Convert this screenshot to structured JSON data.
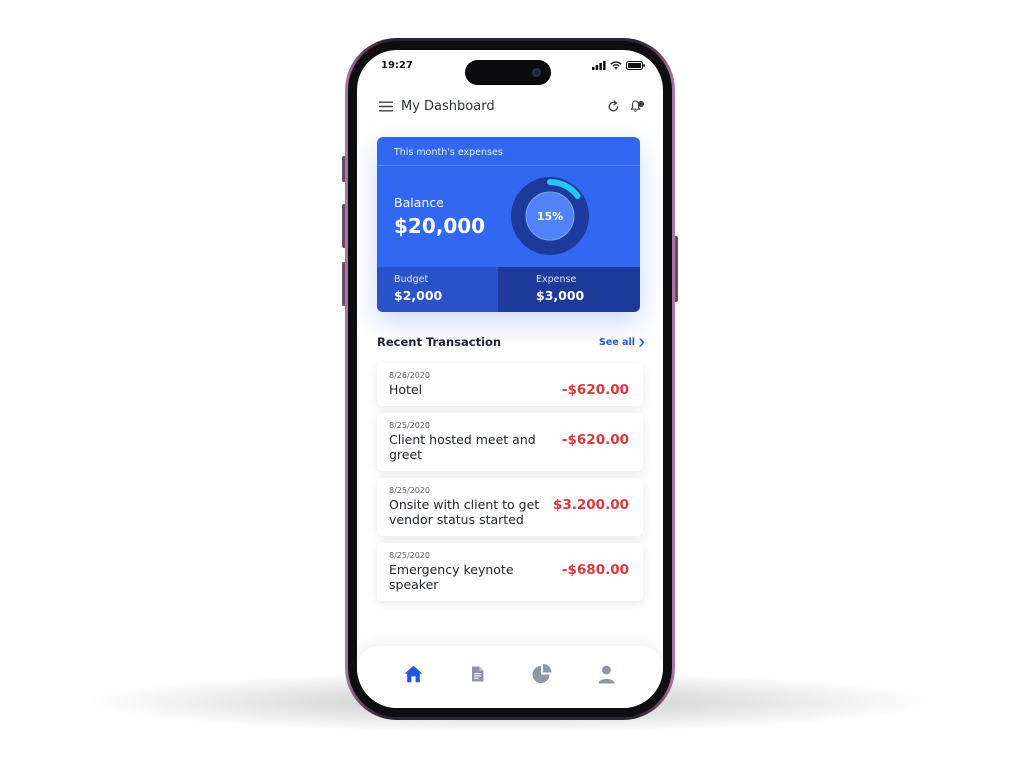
{
  "status_bar": {
    "time": "19:27"
  },
  "header": {
    "title": "My Dashboard"
  },
  "card": {
    "caption": "This month's expenses",
    "balance_label": "Balance",
    "balance_value": "$20,000",
    "percent_label": "15%",
    "percent_fraction": 0.15,
    "budget_label": "Budget",
    "budget_value": "$2,000",
    "expense_label": "Expense",
    "expense_value": "$3,000"
  },
  "recent": {
    "title": "Recent Transaction",
    "see_all": "See all"
  },
  "transactions": [
    {
      "date": "8/26/2020",
      "name": "Hotel",
      "amount": "-$620.00"
    },
    {
      "date": "8/25/2020",
      "name": "Client hosted meet and greet",
      "amount": "-$620.00"
    },
    {
      "date": "8/25/2020",
      "name": "Onsite with client to get vendor status started",
      "amount": "$3.200.00"
    },
    {
      "date": "8/25/2020",
      "name": "Emergency keynote speaker",
      "amount": "-$680.00"
    }
  ],
  "nav": [
    {
      "icon": "home-icon",
      "active": true
    },
    {
      "icon": "document-icon",
      "active": false
    },
    {
      "icon": "pie-chart-icon",
      "active": false
    },
    {
      "icon": "user-icon",
      "active": false
    }
  ],
  "colors": {
    "primary": "#3267f4",
    "budget_panel": "#2a52c9",
    "expense_panel": "#1d3a9b",
    "negative_amount": "#e0363c",
    "ring_progress": "#22c7f5",
    "nav_active": "#2456e6",
    "nav_inactive": "#8f97a6"
  }
}
